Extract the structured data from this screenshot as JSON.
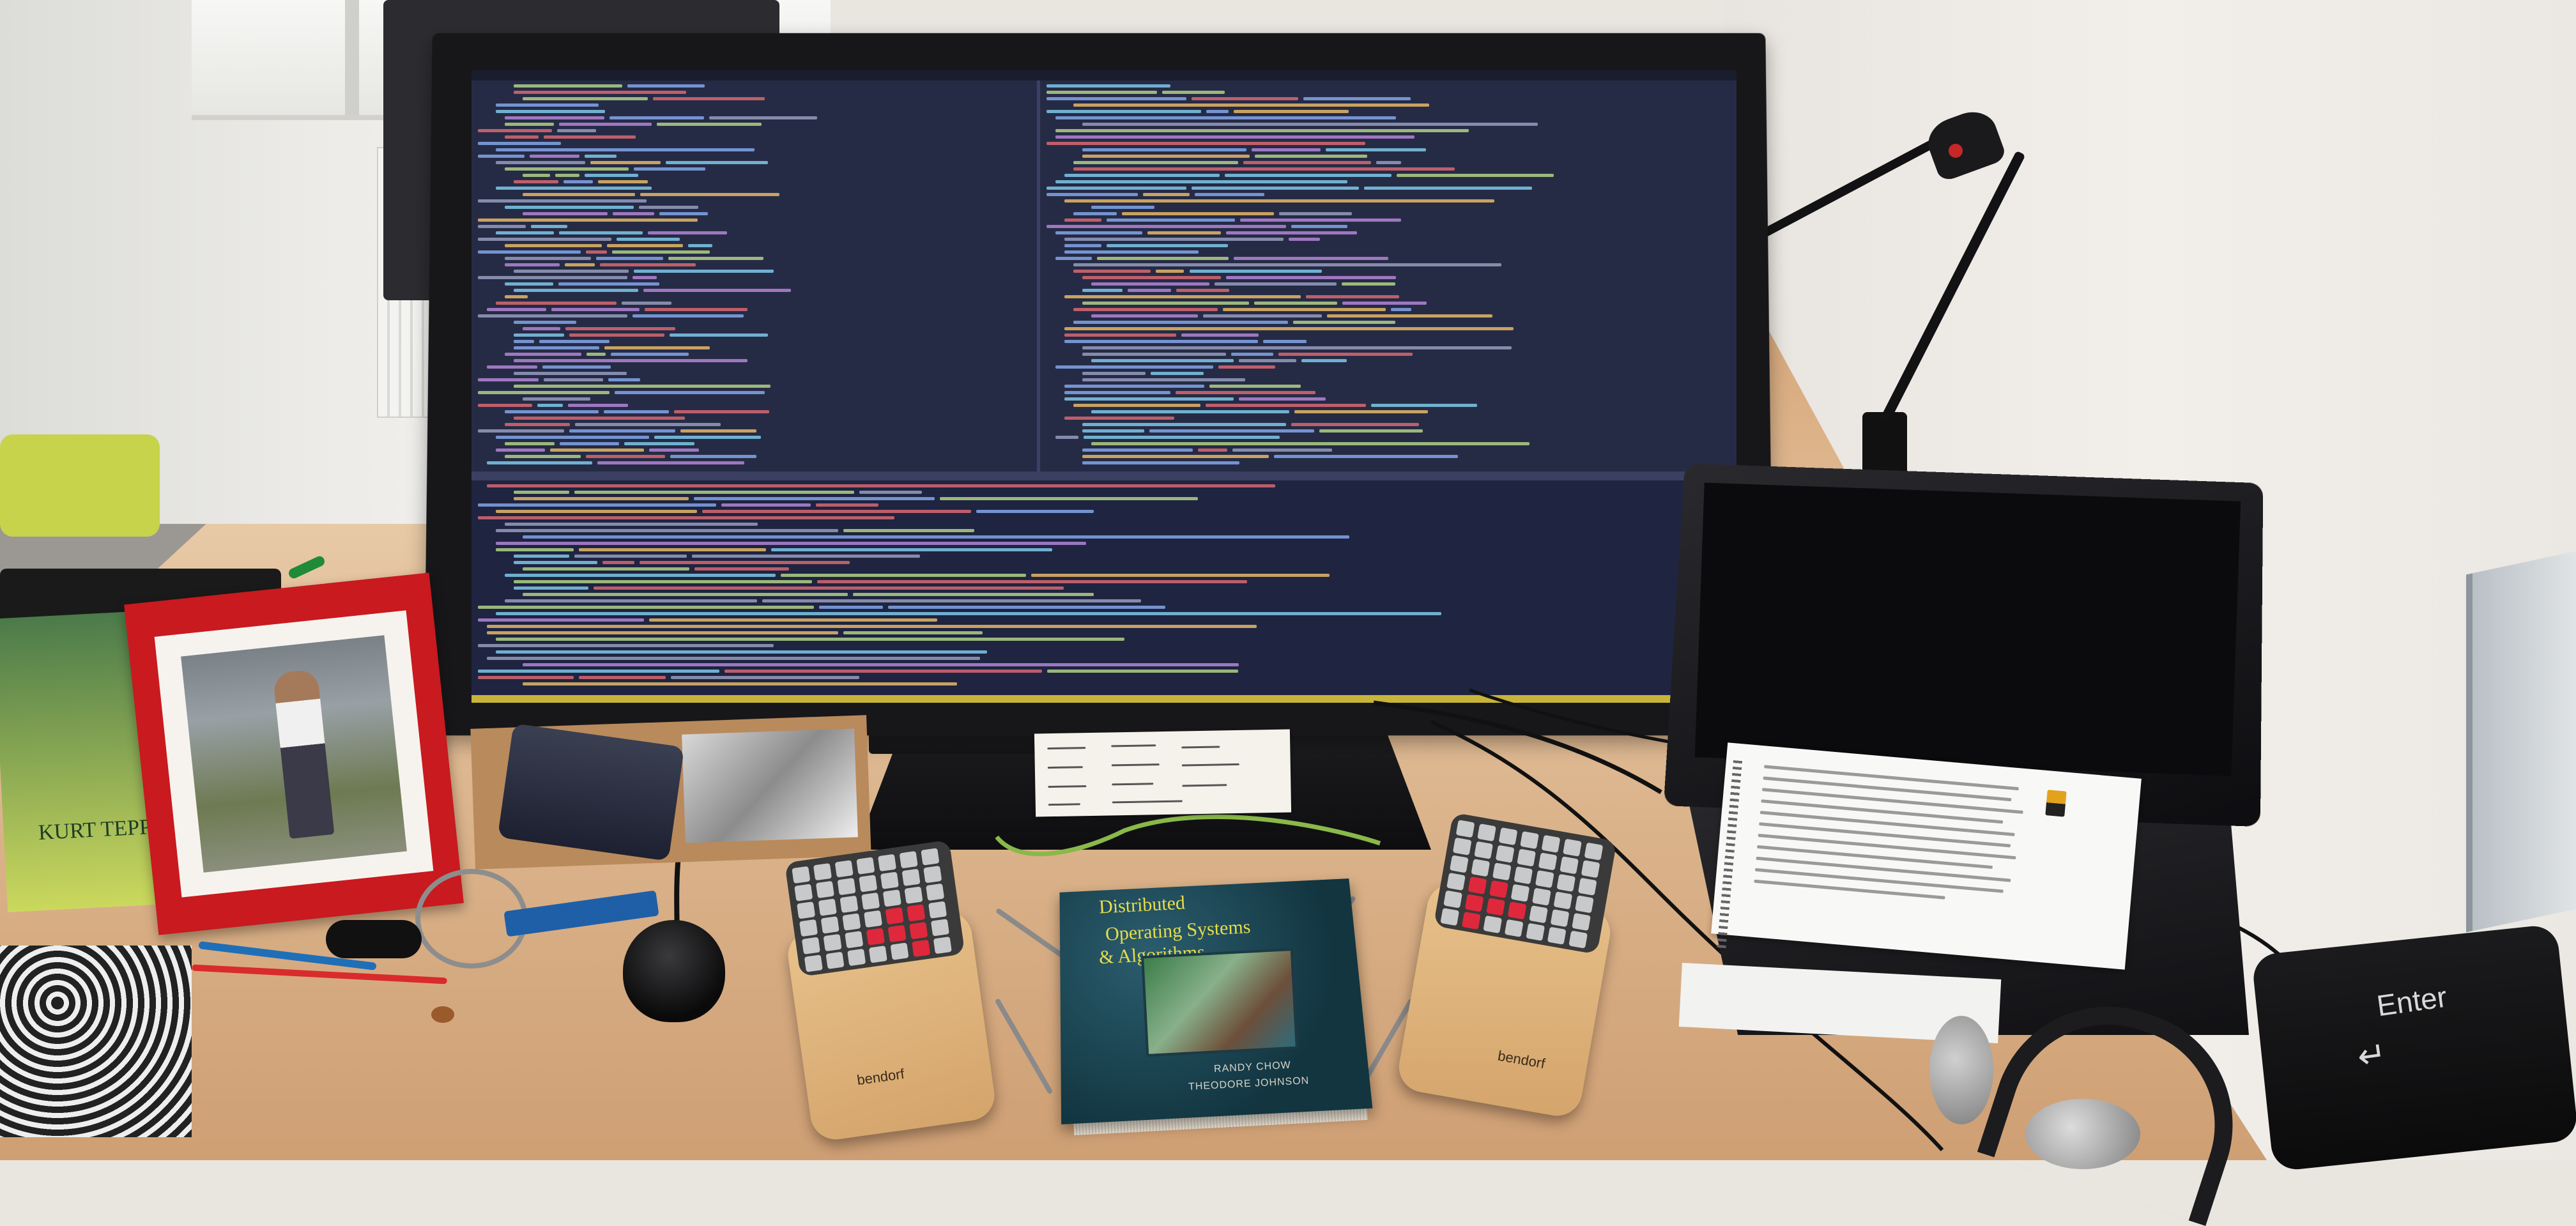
{
  "scene": {
    "description_tags": [
      "monitor-with-code-editor",
      "split-keyboard-left",
      "split-keyboard-right",
      "book",
      "laptop",
      "desk-lamp",
      "photo-frame",
      "enter-key-pillow",
      "headphones",
      "mouse"
    ]
  },
  "book": {
    "title_line1": "Distributed",
    "title_line2": "Operating Systems",
    "title_line3": "& Algorithms",
    "author1": "RANDY CHOW",
    "author2": "THEODORE JOHNSON"
  },
  "keyboards": {
    "left_brand": "bendorf",
    "right_brand": "bendorf"
  },
  "enter_key": {
    "label": "Enter",
    "arrow": "↵"
  },
  "left_book": {
    "label": "KURT TEPPE"
  },
  "colors": {
    "screen_bg": "#262b45",
    "keyboard_accent": "#e0283c",
    "frame_red": "#c81a1f",
    "book_title": "#e7dd4a"
  }
}
